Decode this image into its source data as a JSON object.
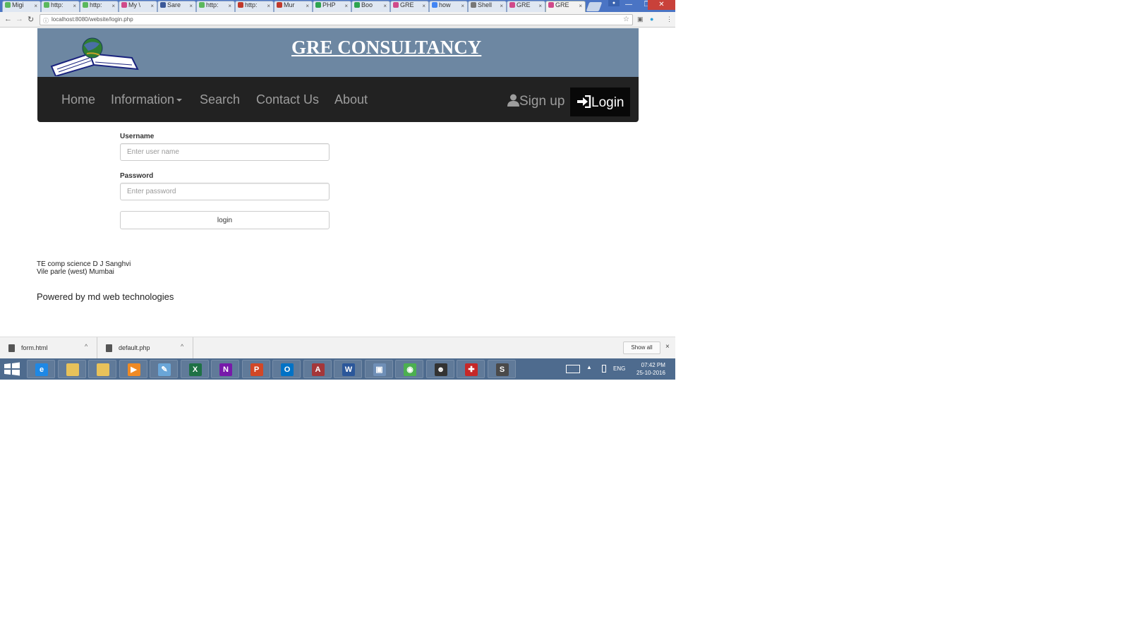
{
  "browser": {
    "tabs": [
      {
        "title": "Migi",
        "color": "#5bb85d"
      },
      {
        "title": "http:",
        "color": "#5bb85d"
      },
      {
        "title": "http:",
        "color": "#5bb85d"
      },
      {
        "title": "My \\",
        "color": "#d04a8a"
      },
      {
        "title": "Sare",
        "color": "#3b5998"
      },
      {
        "title": "http:",
        "color": "#5bb85d"
      },
      {
        "title": "http:",
        "color": "#c0392b"
      },
      {
        "title": "Mur",
        "color": "#c0392b"
      },
      {
        "title": "PHP",
        "color": "#2ea44f"
      },
      {
        "title": "Boo",
        "color": "#2ea44f"
      },
      {
        "title": "GRE",
        "color": "#d04a8a"
      },
      {
        "title": "how",
        "color": "#4285f4"
      },
      {
        "title": "Shell",
        "color": "#777777"
      },
      {
        "title": "GRE",
        "color": "#d04a8a"
      },
      {
        "title": "GRE",
        "color": "#d04a8a"
      }
    ],
    "tab_close": "×",
    "window_buttons": {
      "minimize": "—",
      "maximize": "❐",
      "close": "✕"
    },
    "url": "localhost:8080/website/login.php"
  },
  "site": {
    "title": "GRE CONSULTANCY",
    "nav": {
      "home": "Home",
      "information": "Information",
      "search": "Search",
      "contact": "Contact Us",
      "about": "About",
      "signup": "Sign up",
      "login": "Login"
    },
    "form": {
      "username_label": "Username",
      "username_placeholder": "Enter user name",
      "password_label": "Password",
      "password_placeholder": "Enter password",
      "submit_label": "login"
    },
    "footer": {
      "line1": "TE comp science D J Sanghvi",
      "line2": "Vile parle (west) Mumbai",
      "powered": "Powered by md web technologies"
    }
  },
  "downloads": {
    "items": [
      "form.html",
      "default.php"
    ],
    "show_all": "Show all",
    "close": "×"
  },
  "taskbar": {
    "apps": [
      {
        "icon": "internet-explorer-icon",
        "color": "#1e88e5",
        "glyph": "e"
      },
      {
        "icon": "file-explorer-icon",
        "color": "#e8c25a",
        "glyph": ""
      },
      {
        "icon": "folder-icon",
        "color": "#e8c25a",
        "glyph": ""
      },
      {
        "icon": "media-player-icon",
        "color": "#f08a24",
        "glyph": "▶"
      },
      {
        "icon": "paint-icon",
        "color": "#6aa6d8",
        "glyph": "✎"
      },
      {
        "icon": "excel-icon",
        "color": "#1e7145",
        "glyph": "X"
      },
      {
        "icon": "onenote-icon",
        "color": "#7719aa",
        "glyph": "N"
      },
      {
        "icon": "powerpoint-icon",
        "color": "#d24726",
        "glyph": "P"
      },
      {
        "icon": "outlook-icon",
        "color": "#0072c6",
        "glyph": "O"
      },
      {
        "icon": "access-icon",
        "color": "#a4373a",
        "glyph": "A"
      },
      {
        "icon": "word-icon",
        "color": "#2b579a",
        "glyph": "W"
      },
      {
        "icon": "virtualbox-icon",
        "color": "#6f8fb7",
        "glyph": "▣"
      },
      {
        "icon": "chrome-icon",
        "color": "#4caf50",
        "glyph": "◉"
      },
      {
        "icon": "game-icon",
        "color": "#333333",
        "glyph": "☻"
      },
      {
        "icon": "shield-app-icon",
        "color": "#c62828",
        "glyph": "✚"
      },
      {
        "icon": "sublime-text-icon",
        "color": "#4a4a4a",
        "glyph": "S"
      }
    ],
    "language": "ENG",
    "time": "07:42 PM",
    "date": "25-10-2016"
  }
}
